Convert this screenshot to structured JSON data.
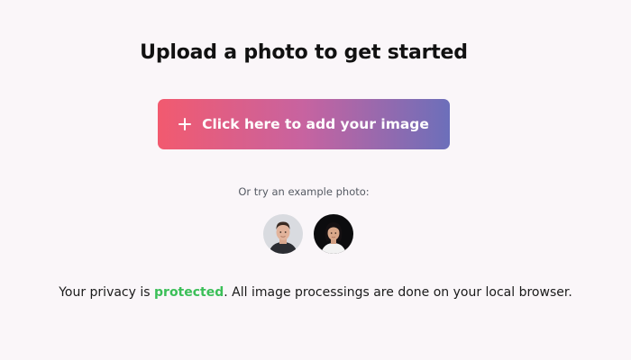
{
  "heading": "Upload a photo to get started",
  "upload_button": {
    "label": "Click here to add your image",
    "icon": "plus-icon"
  },
  "examples": {
    "prompt": "Or try an example photo:",
    "photos": [
      "example-photo-man",
      "example-photo-woman"
    ]
  },
  "privacy": {
    "prefix": "Your privacy is ",
    "highlight": "protected",
    "suffix": ". All image processings are done on your local browser."
  },
  "colors": {
    "background": "#faf6f9",
    "gradient_start": "#f25a6f",
    "gradient_mid": "#c763a0",
    "gradient_end": "#6c6fba",
    "highlight": "#3bbf58"
  }
}
